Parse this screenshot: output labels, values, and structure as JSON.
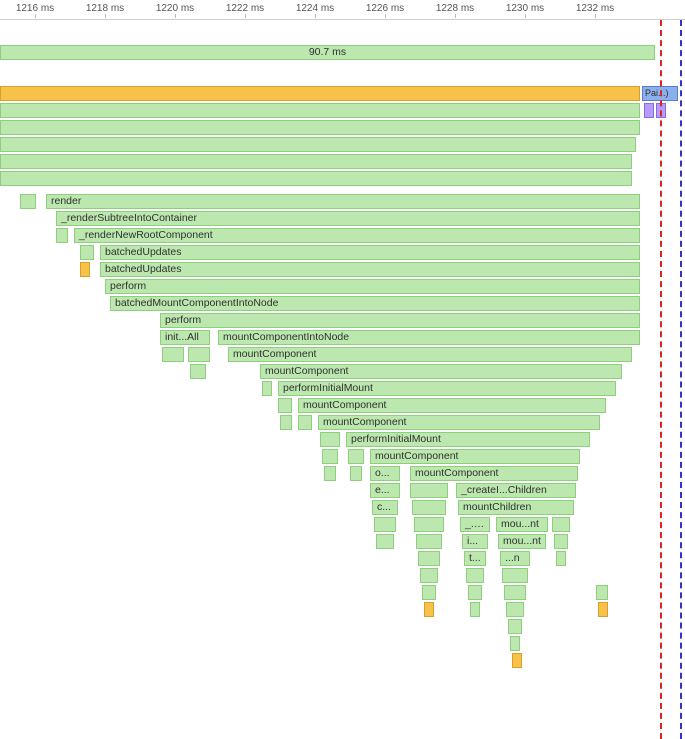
{
  "ruler": {
    "ticks": [
      "1216 ms",
      "1218 ms",
      "1220 ms",
      "1222 ms",
      "1224 ms",
      "1226 ms",
      "1228 ms",
      "1230 ms",
      "1232 ms"
    ]
  },
  "summary_label": "90.7 ms",
  "task_label": "Pai...)",
  "frames": {
    "render": "render",
    "renderSubtree": "_renderSubtreeIntoContainer",
    "renderNewRoot": "_renderNewRootComponent",
    "batchedUpdates": "batchedUpdates",
    "perform": "perform",
    "batchedMount": "batchedMountComponentIntoNode",
    "initAll": "init...All",
    "mountIntoNode": "mountComponentIntoNode",
    "mountComponent": "mountComponent",
    "performInitial": "performInitialMount",
    "createChildren": "_createI...Children",
    "mountChildren": "mountChildren",
    "o": "o...",
    "e": "e...",
    "c": "c...",
    "un": "_...n",
    "in": "i...",
    "tn": "t...",
    "mount": "mou...nt",
    "nn": "...n"
  }
}
